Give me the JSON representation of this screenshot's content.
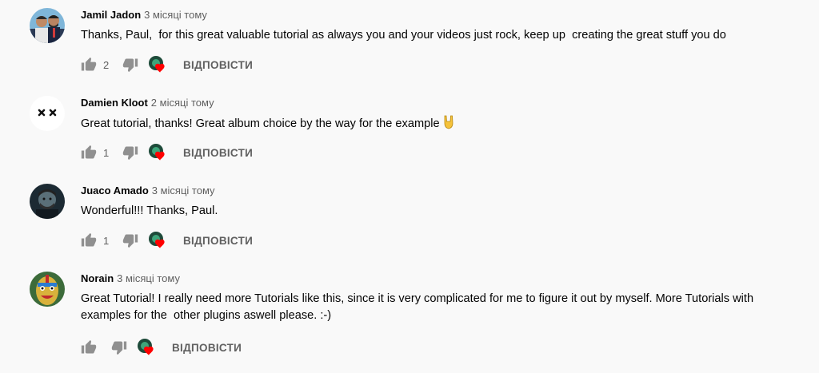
{
  "reply_label": "ВІДПОВІСТИ",
  "colors": {
    "heart": "#ff0000",
    "icon": "#909090",
    "meta": "#606060"
  },
  "comments": [
    {
      "author": "Jamil Jadon",
      "time": "3 місяці тому",
      "text": "Thanks, Paul,  for this great valuable tutorial as always you and your videos just rock, keep up  creating the great stuff you do",
      "likes": "2",
      "avatar_icon": "two-men-photo"
    },
    {
      "author": "Damien Kloot",
      "time": "2 місяці тому",
      "text": "Great tutorial, thanks! Great album choice by the way for the example",
      "likes": "1",
      "avatar_icon": "xx-face-icon"
    },
    {
      "author": "Juaco Amado",
      "time": "3 місяці тому",
      "text": "Wonderful!!! Thanks, Paul.",
      "likes": "1",
      "avatar_icon": "dark-portrait-photo"
    },
    {
      "author": "Norain",
      "time": "3 місяці тому",
      "text": "Great Tutorial! I really need more Tutorials like this, since it is very complicated for me to figure it out by myself. More Tutorials with examples for the  other plugins aswell please. :-)",
      "likes": "",
      "avatar_icon": "tribal-mask-photo"
    }
  ]
}
